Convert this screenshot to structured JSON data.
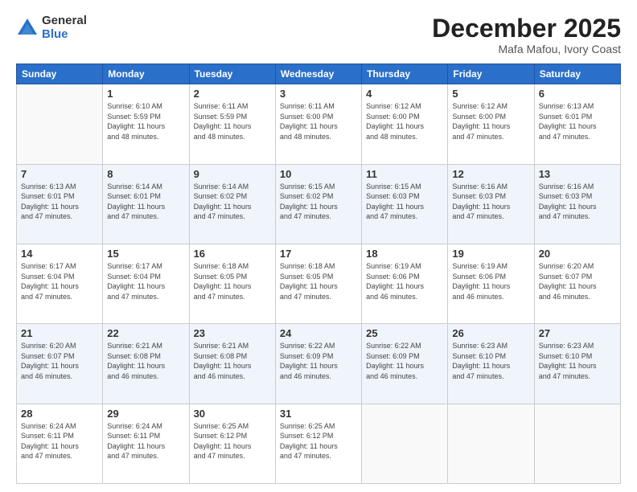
{
  "logo": {
    "general": "General",
    "blue": "Blue"
  },
  "title": "December 2025",
  "subtitle": "Mafa Mafou, Ivory Coast",
  "days": [
    "Sunday",
    "Monday",
    "Tuesday",
    "Wednesday",
    "Thursday",
    "Friday",
    "Saturday"
  ],
  "weeks": [
    [
      {
        "day": "",
        "info": ""
      },
      {
        "day": "1",
        "info": "Sunrise: 6:10 AM\nSunset: 5:59 PM\nDaylight: 11 hours\nand 48 minutes."
      },
      {
        "day": "2",
        "info": "Sunrise: 6:11 AM\nSunset: 5:59 PM\nDaylight: 11 hours\nand 48 minutes."
      },
      {
        "day": "3",
        "info": "Sunrise: 6:11 AM\nSunset: 6:00 PM\nDaylight: 11 hours\nand 48 minutes."
      },
      {
        "day": "4",
        "info": "Sunrise: 6:12 AM\nSunset: 6:00 PM\nDaylight: 11 hours\nand 48 minutes."
      },
      {
        "day": "5",
        "info": "Sunrise: 6:12 AM\nSunset: 6:00 PM\nDaylight: 11 hours\nand 47 minutes."
      },
      {
        "day": "6",
        "info": "Sunrise: 6:13 AM\nSunset: 6:01 PM\nDaylight: 11 hours\nand 47 minutes."
      }
    ],
    [
      {
        "day": "7",
        "info": "Sunrise: 6:13 AM\nSunset: 6:01 PM\nDaylight: 11 hours\nand 47 minutes."
      },
      {
        "day": "8",
        "info": "Sunrise: 6:14 AM\nSunset: 6:01 PM\nDaylight: 11 hours\nand 47 minutes."
      },
      {
        "day": "9",
        "info": "Sunrise: 6:14 AM\nSunset: 6:02 PM\nDaylight: 11 hours\nand 47 minutes."
      },
      {
        "day": "10",
        "info": "Sunrise: 6:15 AM\nSunset: 6:02 PM\nDaylight: 11 hours\nand 47 minutes."
      },
      {
        "day": "11",
        "info": "Sunrise: 6:15 AM\nSunset: 6:03 PM\nDaylight: 11 hours\nand 47 minutes."
      },
      {
        "day": "12",
        "info": "Sunrise: 6:16 AM\nSunset: 6:03 PM\nDaylight: 11 hours\nand 47 minutes."
      },
      {
        "day": "13",
        "info": "Sunrise: 6:16 AM\nSunset: 6:03 PM\nDaylight: 11 hours\nand 47 minutes."
      }
    ],
    [
      {
        "day": "14",
        "info": "Sunrise: 6:17 AM\nSunset: 6:04 PM\nDaylight: 11 hours\nand 47 minutes."
      },
      {
        "day": "15",
        "info": "Sunrise: 6:17 AM\nSunset: 6:04 PM\nDaylight: 11 hours\nand 47 minutes."
      },
      {
        "day": "16",
        "info": "Sunrise: 6:18 AM\nSunset: 6:05 PM\nDaylight: 11 hours\nand 47 minutes."
      },
      {
        "day": "17",
        "info": "Sunrise: 6:18 AM\nSunset: 6:05 PM\nDaylight: 11 hours\nand 47 minutes."
      },
      {
        "day": "18",
        "info": "Sunrise: 6:19 AM\nSunset: 6:06 PM\nDaylight: 11 hours\nand 46 minutes."
      },
      {
        "day": "19",
        "info": "Sunrise: 6:19 AM\nSunset: 6:06 PM\nDaylight: 11 hours\nand 46 minutes."
      },
      {
        "day": "20",
        "info": "Sunrise: 6:20 AM\nSunset: 6:07 PM\nDaylight: 11 hours\nand 46 minutes."
      }
    ],
    [
      {
        "day": "21",
        "info": "Sunrise: 6:20 AM\nSunset: 6:07 PM\nDaylight: 11 hours\nand 46 minutes."
      },
      {
        "day": "22",
        "info": "Sunrise: 6:21 AM\nSunset: 6:08 PM\nDaylight: 11 hours\nand 46 minutes."
      },
      {
        "day": "23",
        "info": "Sunrise: 6:21 AM\nSunset: 6:08 PM\nDaylight: 11 hours\nand 46 minutes."
      },
      {
        "day": "24",
        "info": "Sunrise: 6:22 AM\nSunset: 6:09 PM\nDaylight: 11 hours\nand 46 minutes."
      },
      {
        "day": "25",
        "info": "Sunrise: 6:22 AM\nSunset: 6:09 PM\nDaylight: 11 hours\nand 46 minutes."
      },
      {
        "day": "26",
        "info": "Sunrise: 6:23 AM\nSunset: 6:10 PM\nDaylight: 11 hours\nand 47 minutes."
      },
      {
        "day": "27",
        "info": "Sunrise: 6:23 AM\nSunset: 6:10 PM\nDaylight: 11 hours\nand 47 minutes."
      }
    ],
    [
      {
        "day": "28",
        "info": "Sunrise: 6:24 AM\nSunset: 6:11 PM\nDaylight: 11 hours\nand 47 minutes."
      },
      {
        "day": "29",
        "info": "Sunrise: 6:24 AM\nSunset: 6:11 PM\nDaylight: 11 hours\nand 47 minutes."
      },
      {
        "day": "30",
        "info": "Sunrise: 6:25 AM\nSunset: 6:12 PM\nDaylight: 11 hours\nand 47 minutes."
      },
      {
        "day": "31",
        "info": "Sunrise: 6:25 AM\nSunset: 6:12 PM\nDaylight: 11 hours\nand 47 minutes."
      },
      {
        "day": "",
        "info": ""
      },
      {
        "day": "",
        "info": ""
      },
      {
        "day": "",
        "info": ""
      }
    ]
  ]
}
